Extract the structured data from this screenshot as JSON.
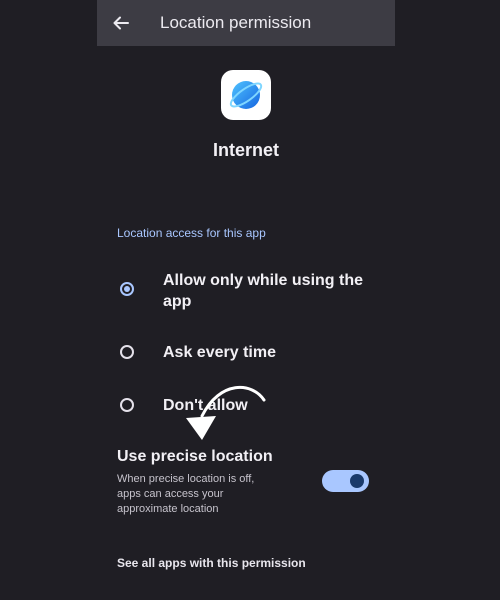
{
  "appbar": {
    "back_icon": "arrow-left-icon",
    "title": "Location permission"
  },
  "app": {
    "icon": "internet-globe-icon",
    "name": "Internet"
  },
  "section_label": "Location access for this app",
  "options": [
    {
      "label": "Allow only while using the app",
      "selected": true
    },
    {
      "label": "Ask every time",
      "selected": false
    },
    {
      "label": "Don't allow",
      "selected": false
    }
  ],
  "precise": {
    "title": "Use precise location",
    "description": "When precise location is off, apps can access your approximate location",
    "enabled": true
  },
  "footer_link": "See all apps with this permission",
  "colors": {
    "background": "#1f1e24",
    "appbar": "#3d3c44",
    "accent": "#a9c7ff",
    "toggle_thumb": "#1a3a6b",
    "annotation_arrow": "#ffffff"
  }
}
